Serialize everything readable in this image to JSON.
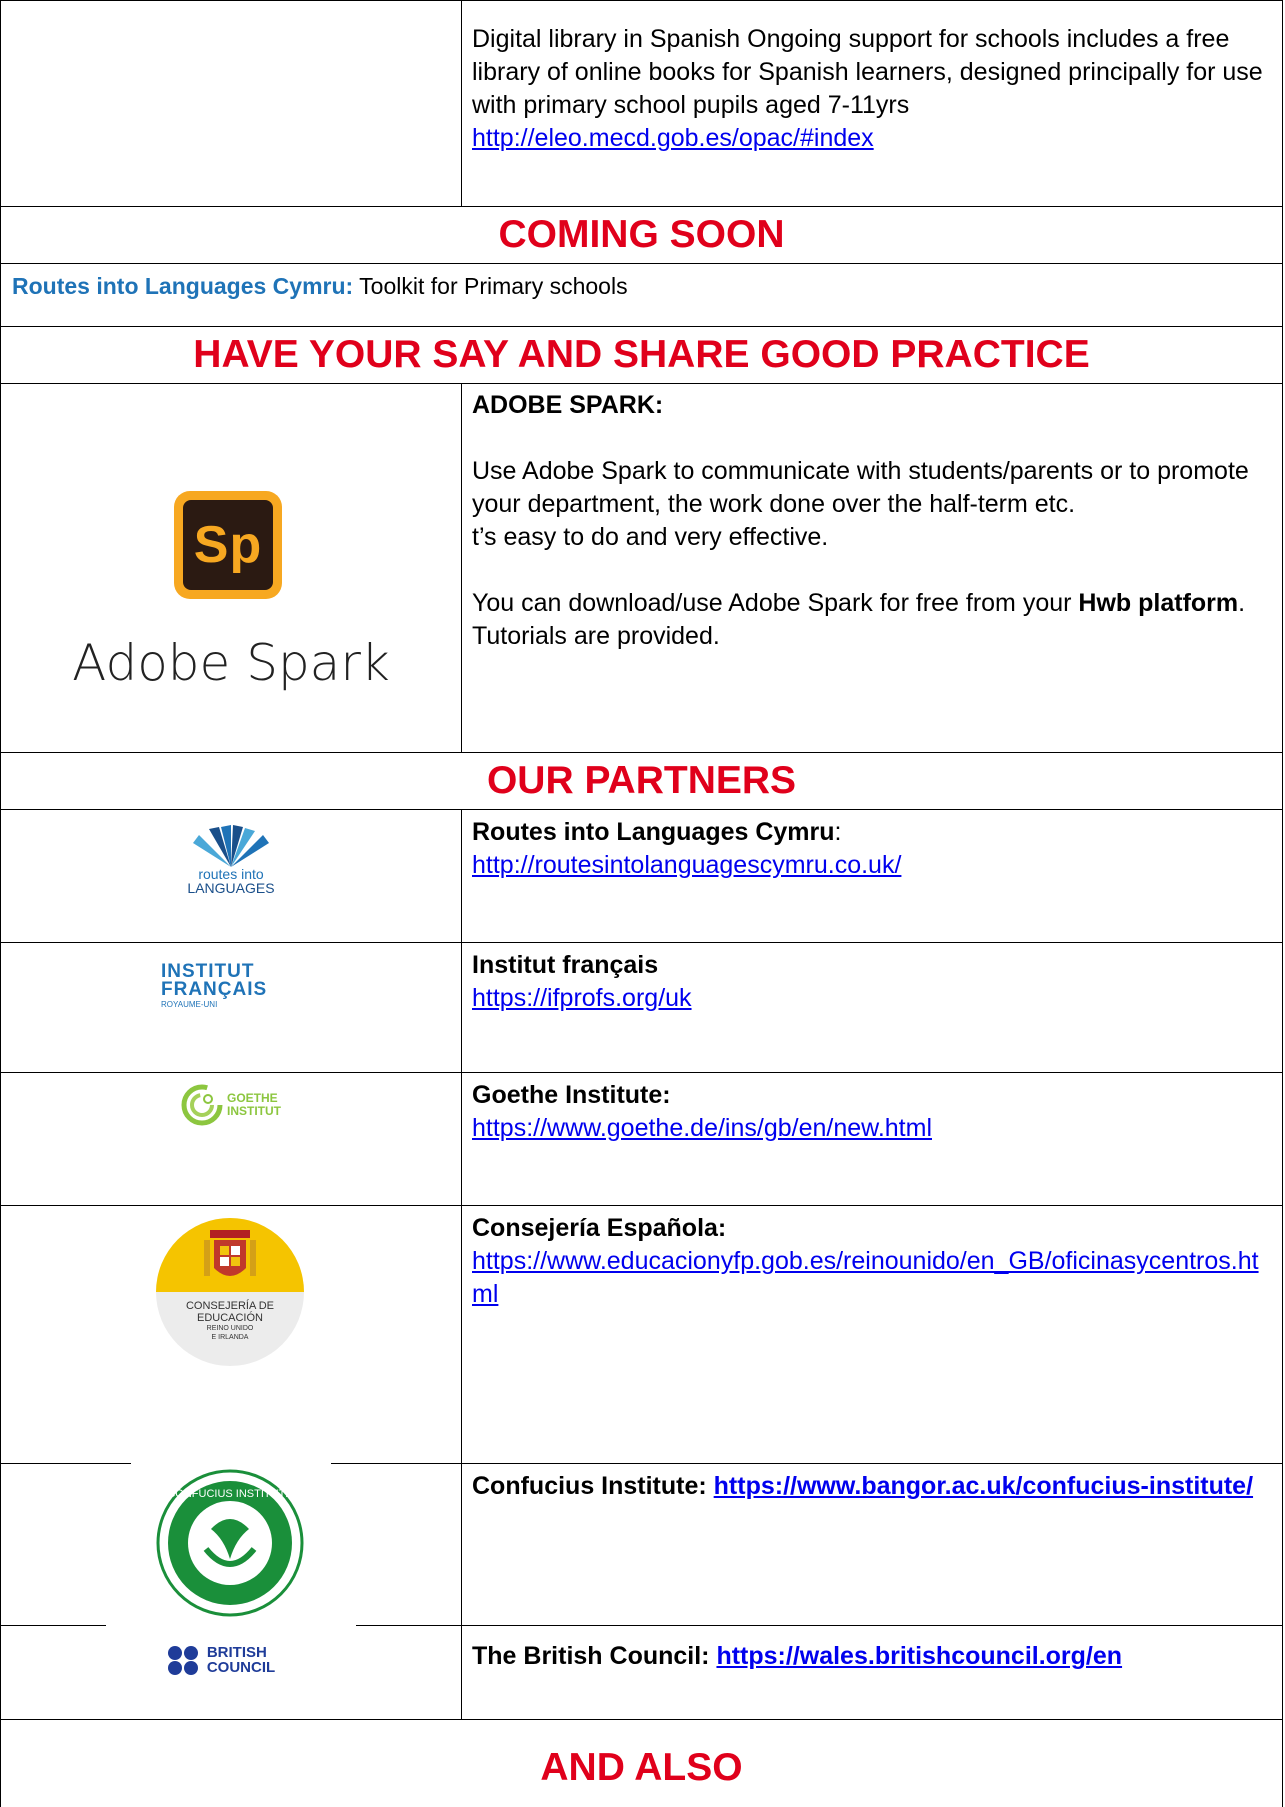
{
  "spanish_library": {
    "description": "Digital library in Spanish Ongoing support for schools includes a free library of online books for Spanish learners, designed principally for use with primary school pupils aged 7-11yrs",
    "link": "http://eleo.mecd.gob.es/opac/#index"
  },
  "coming_soon": {
    "heading": "COMING SOON",
    "org": "Routes into Languages Cymru:",
    "text": " Toolkit for Primary schools"
  },
  "share": {
    "heading": "HAVE YOUR SAY AND SHARE GOOD PRACTICE",
    "logo_mark": "Sp",
    "logo_word": "Adobe Spark",
    "title": "ADOBE SPARK:",
    "para1": "Use Adobe Spark to communicate with students/parents or to promote your department, the work done over the half-term etc.",
    "para2": "t’s easy to do and very effective.",
    "para3_pre": "You can download/use Adobe Spark for free from your ",
    "para3_bold": "Hwb platform",
    "para3_post": ".",
    "para4": "Tutorials are provided."
  },
  "partners": {
    "heading": "OUR PARTNERS",
    "items": [
      {
        "name": "Routes into Languages Cymru",
        "suffix": ":",
        "link": "http://routesintolanguagescymru.co.uk/",
        "logo_line1": "routes into",
        "logo_line2": "LANGUAGES"
      },
      {
        "name": "Institut français",
        "suffix": "",
        "link": "https://ifprofs.org/uk",
        "logo_line1": "INSTITUT",
        "logo_line2": "FRANÇAIS",
        "logo_line3": "ROYAUME-UNI"
      },
      {
        "name": "Goethe Institute:",
        "suffix": "",
        "link": "https://www.goethe.de/ins/gb/en/new.html",
        "logo_line1": "GOETHE",
        "logo_line2": "INSTITUT"
      },
      {
        "name": "Consejería Española:",
        "suffix": "",
        "link": "https://www.educacionyfp.gob.es/reinounido/en_GB/oficinasycentros.html",
        "logo_line1": "CONSEJERÍA DE",
        "logo_line2": "EDUCACIÓN",
        "logo_line3": "REINO UNIDO",
        "logo_line4": "E IRLANDA"
      },
      {
        "name": "Confucius Institute: ",
        "suffix": "",
        "link": "https://www.bangor.ac.uk/confucius-institute/",
        "logo_line1": "CONFUCIUS INSTITUTE"
      },
      {
        "name": "The British Council: ",
        "suffix": "",
        "link": "https://wales.britishcouncil.org/en",
        "logo_line1": "BRITISH",
        "logo_line2": "COUNCIL"
      }
    ]
  },
  "and_also": {
    "heading": "AND ALSO"
  },
  "colors": {
    "heading_red": "#e0001b",
    "org_blue": "#1f73b7",
    "link_blue": "#0000ee",
    "spark_bg": "#2b1a12",
    "spark_orange": "#f7a821"
  }
}
